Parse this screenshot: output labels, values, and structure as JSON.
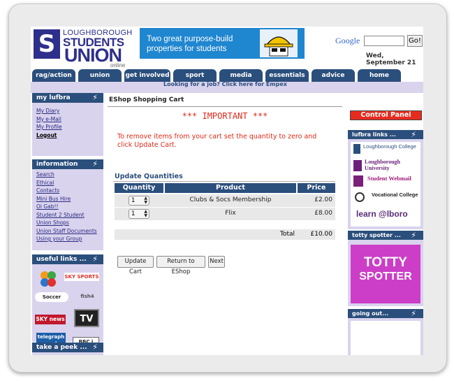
{
  "header": {
    "logo_line1": "LOUGHBOROUGH",
    "logo_line2": "STUDENTS",
    "logo_line3": "UNION",
    "logo_sub": "online",
    "logo_mark": "S",
    "banner_text": "Two great purpose-build properties for students",
    "search_brand": "Google",
    "search_value": "",
    "go_label": "Go!",
    "date": "Wed, September 21"
  },
  "nav": {
    "tabs": [
      "rag/action",
      "union",
      "get involved",
      "sport",
      "media",
      "essentials",
      "advice",
      "home"
    ]
  },
  "strip_text": "Looking for a job? Click here for Empex",
  "left": {
    "my_lufbra": {
      "title": "my lufbra",
      "links": [
        "My Diary",
        "My e-Mail",
        "My Profile",
        "Logout"
      ]
    },
    "information": {
      "title": "information",
      "links": [
        "Search",
        "Ethical",
        "Contacts",
        "Mini Bus Hire",
        "Oi Gab!!",
        "Student 2 Student",
        "Union Shops",
        "Union Staff Documents",
        "Using your Group"
      ]
    },
    "useful_links": {
      "title": "useful links ...",
      "logos": [
        "SKY SPORTS",
        "Soccer",
        "fish4",
        "SKY news",
        "TV",
        "telegraph co.uk",
        "BBC i"
      ]
    },
    "take_a_peek": {
      "title": "take a peek ..."
    }
  },
  "main": {
    "title": "EShop Shopping Cart",
    "important": "*** IMPORTANT ***",
    "instructions": "To remove items from your cart set the quantity to zero and click Update Cart.",
    "update_title": "Update Quantities",
    "columns": [
      "Quantity",
      "Product",
      "Price"
    ],
    "rows": [
      {
        "qty": "1",
        "product": "Clubs & Socs Membership",
        "price": "£2.00"
      },
      {
        "qty": "1",
        "product": "Flix",
        "price": "£8.00"
      }
    ],
    "total_label": "Total",
    "total_value": "£10.00",
    "buttons": {
      "update": "Update Cart",
      "return": "Return to EShop",
      "next": "Next"
    }
  },
  "right": {
    "control_panel": "Control Panel",
    "lufbra_links": {
      "title": "lufbra links ...",
      "items": [
        "Loughborough College",
        "Loughborough University",
        "Student Webmail",
        "Vocational College",
        "learn @lboro"
      ]
    },
    "totty": {
      "title": "totty spotter ...",
      "logo_line1": "TOTTY",
      "logo_line2": "SPOTTER"
    },
    "going_out": {
      "title": "going out..."
    }
  },
  "colors": {
    "nav_blue": "#2b4f7c",
    "lavender": "#d9d3ee",
    "alert_red": "#e02a1a",
    "totty_pink": "#cc3ec7"
  }
}
